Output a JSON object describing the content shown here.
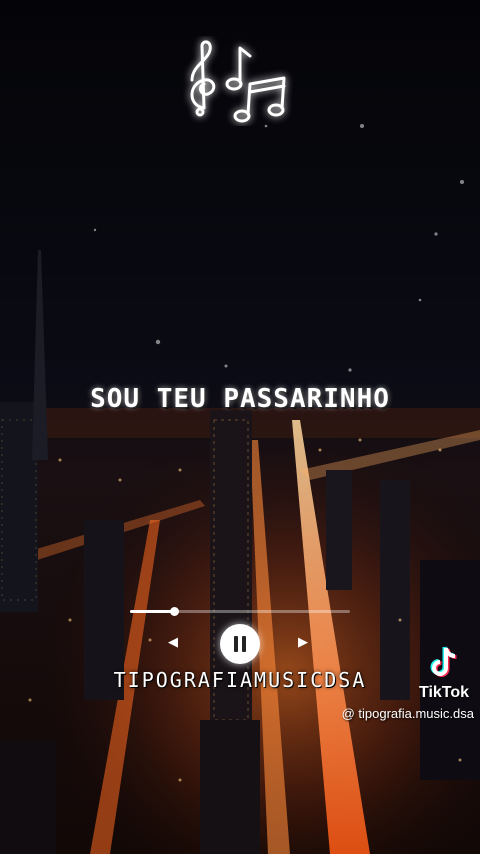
{
  "overlay": {
    "lyric": "SOU TEU PASSARINHO",
    "brand": "TIPOGRAFIAMUSICDSA"
  },
  "player": {
    "progress": 0.2
  },
  "icons": {
    "notes": "music-notes-icon",
    "prev": "skip-back-icon",
    "pause": "pause-icon",
    "next": "skip-forward-icon",
    "tiktok": "tiktok-logo-icon"
  },
  "tiktok": {
    "name": "TikTok",
    "handle": "@ tipografia.music.dsa"
  },
  "colors": {
    "sky": "#05050a",
    "city_glow": "#ff6a1a",
    "neon_blue": "#2a6cff"
  }
}
